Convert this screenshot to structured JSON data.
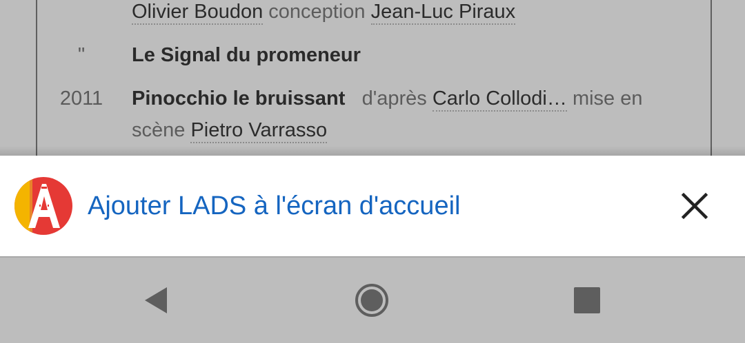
{
  "page": {
    "row1": {
      "person1": "Olivier Boudon",
      "role": "conception",
      "person2": "Jean-Luc Piraux"
    },
    "row2": {
      "year": "\"",
      "title": "Le Signal du promeneur"
    },
    "row3": {
      "year": "2011",
      "title": "Pinocchio le bruissant",
      "after_prefix": "d'après",
      "author": "Carlo Collodi…",
      "staging": "mise en"
    },
    "row4": {
      "staging_cont": "scène",
      "director": "Pietro Varrasso"
    }
  },
  "banner": {
    "label": "Ajouter LADS à l'écran d'accueil",
    "icon": "lads-app-icon",
    "close_icon": "close-icon",
    "colors": {
      "label": "#1565c0",
      "icon_red": "#e53935",
      "icon_yellow": "#f4b400"
    }
  },
  "navbar": {
    "back_icon": "back-triangle-icon",
    "home_icon": "home-circle-icon",
    "recents_icon": "recents-square-icon"
  }
}
